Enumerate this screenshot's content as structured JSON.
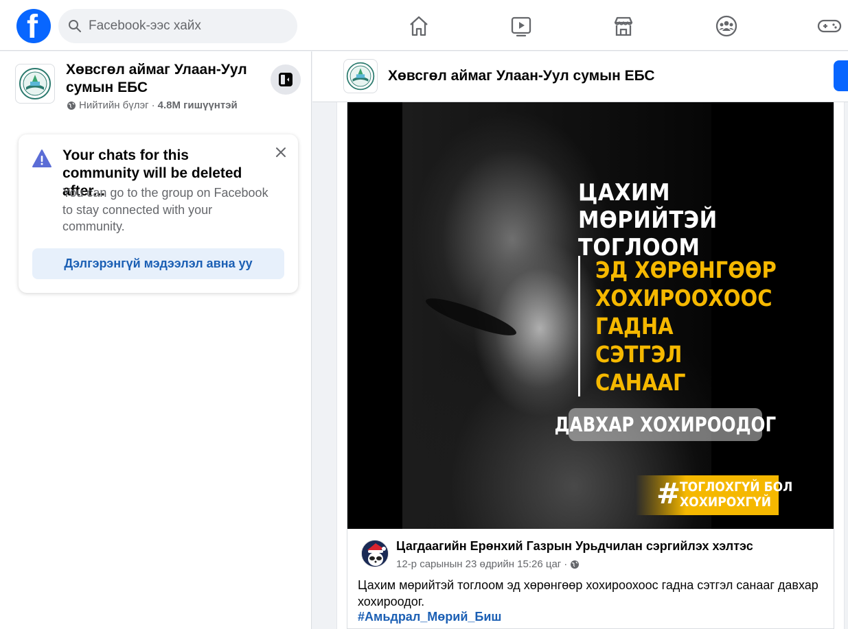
{
  "topbar": {
    "logo_letter": "f",
    "search_placeholder": "Facebook-ээс хайх",
    "nav_icons": [
      "home-icon",
      "video-icon",
      "marketplace-icon",
      "groups-icon",
      "gaming-icon"
    ]
  },
  "group": {
    "name": "Хөвсгөл аймаг Улаан-Уул сумын ЕБС",
    "privacy": "Нийтийн бүлэг",
    "separator": "·",
    "members": "4.8M гишүүнтэй"
  },
  "notice": {
    "title": "Your chats for this community will be deleted after...",
    "body": "You can go to the group on Facebook to stay connected with your community.",
    "button_label": "Дэлгэрэнгүй мэдээлэл авна уу"
  },
  "post": {
    "image": {
      "headline": "ЦАХИМ МӨРИЙТЭЙ ТОГЛООМ",
      "lines": [
        "ЭД ХӨРӨНГӨӨР",
        "ХОХИРООХООС",
        "ГАДНА",
        "СЭТГЭЛ",
        "САНААГ"
      ],
      "pill": "ДАВХАР ХОХИРООДОГ",
      "hash": "#",
      "tag_line1": "ТОГЛОХГҮЙ БОЛ",
      "tag_line2": "ХОХИРОХГҮЙ"
    },
    "author": "Цагдаагийн Ерөнхий Газрын Урьдчилан сэргийлэх хэлтэс",
    "time": "12-р сарынын 23 өдрийн 15:26 цаг",
    "time_separator": "·",
    "text": "Цахим мөрийтэй тоглоом эд хөрөнгөөр хохироохоос гадна сэтгэл санааг давхар хохироодог.",
    "hashtag": "#Амьдрал_Мөрий_Биш"
  },
  "colors": {
    "brand": "#0866ff",
    "link": "#1b5fb4",
    "accent_yellow": "#f5b800",
    "warning": "#5b6dd6"
  }
}
